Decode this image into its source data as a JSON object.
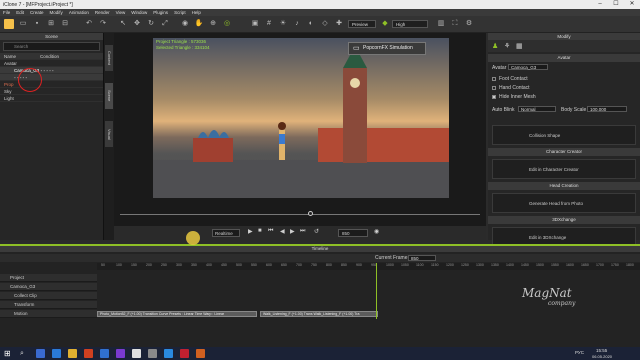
{
  "window": {
    "title": "iClone 7 - [MFProject.iProject *]"
  },
  "menu": [
    "File",
    "Edit",
    "Create",
    "Modify",
    "Animation",
    "Render",
    "View",
    "Window",
    "Plugins",
    "Script",
    "Help"
  ],
  "toolbar": {
    "preview_label": "Preview",
    "quality_label": "High"
  },
  "scene": {
    "title": "Scene",
    "search_placeholder": "Search",
    "col_name": "Name",
    "col_condition": "Condition",
    "items": [
      "Avatar",
      "Camoca_G3",
      "Prop",
      "Sky",
      "Light"
    ]
  },
  "side_tabs": [
    "Content",
    "Scene",
    "Visual"
  ],
  "viewport": {
    "project_triangle_label": "Project Triangle : 573036",
    "selected_triangle_label": "Selected Triangle : 334104",
    "popcorn_label": "PopcornFX Simulation"
  },
  "playbar": {
    "mode": "Realtime",
    "frame": "850"
  },
  "modify": {
    "title": "Modify",
    "avatar_section": "Avatar",
    "avatar_label": "Avatar",
    "avatar_name": "Camoca_G3",
    "foot_contact": "Foot Contact",
    "hand_contact": "Hand Contact",
    "hide_inner_mesh": "Hide Inner Mesh",
    "auto_blink_label": "Auto Blink",
    "auto_blink_value": "Normal",
    "body_scale_label": "Body Scale",
    "body_scale_value": "100.000",
    "collision_label": "Collision Shape",
    "character_creator_section": "Character Creator",
    "edit_cc_label": "Edit in Character Creator",
    "head_creator_section": "Head Creation",
    "head_label": "Generate Head from Photo",
    "threedx_section": "3DXchange",
    "threedx_label": "Edit in 3DXchange"
  },
  "timeline": {
    "title": "Timeline",
    "current_frame_label": "Current Frame",
    "current_frame_value": "850",
    "tracks": [
      "Project",
      "Camoca_G3",
      "Collect Clip",
      "Transform",
      "Motion"
    ],
    "ruler": [
      "50",
      "100",
      "150",
      "200",
      "250",
      "300",
      "350",
      "400",
      "450",
      "500",
      "550",
      "600",
      "650",
      "700",
      "750",
      "800",
      "850",
      "900",
      "950",
      "1000",
      "1050",
      "1100",
      "1150",
      "1200",
      "1250",
      "1300",
      "1350",
      "1400",
      "1450",
      "1500",
      "1550",
      "1600",
      "1650",
      "1700",
      "1750",
      "1800"
    ],
    "clip1": "Photo_Motion52_F (+1.00) Transition Curve Presets : Linear  Time Warp : Linear",
    "clip2": "Walk_Listening_F (+1.00) Trans  Walk_Listening_F (+1.00) Tra"
  },
  "watermark": {
    "line1": "MagNat",
    "line2": "company"
  },
  "taskbar": {
    "time": "15:55",
    "date": "06.05.2020",
    "lang": "РУС"
  }
}
